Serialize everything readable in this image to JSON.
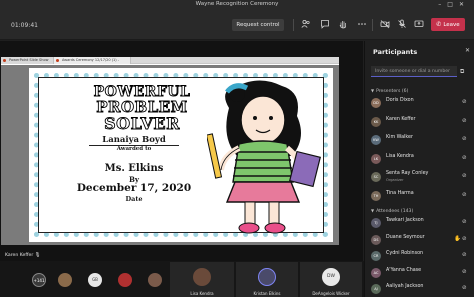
{
  "window": {
    "title": "Wayne Recognition Ceremony",
    "controls": [
      "–",
      "□",
      "✕"
    ]
  },
  "toolbar": {
    "timer": "01:09:41",
    "request_control_label": "Request control",
    "leave_label": "Leave"
  },
  "powerpoint": {
    "tab1": "PowerPoint Slide Show",
    "tab2": "Awards Ceremony 12/17/20 (1) - PowerPoint"
  },
  "certificate": {
    "title_line1": "POWERFUL",
    "title_line2": "PROBLEM",
    "title_line3": "SOLVER",
    "recipient": "Lanaiya Boyd",
    "awarded_to": "Awarded to",
    "presenter": "Ms. Elkins",
    "by": "By",
    "date": "December 17, 2020",
    "date_label": "Date"
  },
  "participants": {
    "title": "Participants",
    "invite_placeholder": "Invite someone or dial a number",
    "presenters_header": "Presenters (6)",
    "presenters": [
      {
        "name": "Doris Dixon",
        "initials": "DD",
        "color": "#8a6d5a"
      },
      {
        "name": "Karen Keffer",
        "initials": "KK",
        "color": "#6b5a4a"
      },
      {
        "name": "Kim Walker",
        "initials": "KW",
        "color": "#5a6b7a"
      },
      {
        "name": "Lisa Kendra",
        "initials": "LK",
        "color": "#7a5a5a"
      },
      {
        "name": "Senta Ray Conley",
        "role": "Organizer",
        "initials": "SC",
        "color": "#6a6a5a"
      },
      {
        "name": "Tina Harma",
        "initials": "TH",
        "color": "#7a6a5a"
      }
    ],
    "attendees_header": "Attendees (143)",
    "attendees": [
      {
        "name": "Tawkari Jackson",
        "initials": "TJ",
        "color": "#5a5a6a",
        "hand": false
      },
      {
        "name": "Duane Seymour",
        "initials": "DS",
        "color": "#6a5a5a",
        "hand": true
      },
      {
        "name": "Cydni Robinson",
        "initials": "CR",
        "color": "#5a6a6a",
        "hand": false
      },
      {
        "name": "A'Yanna Chase",
        "initials": "AC",
        "color": "#7a5a6a",
        "hand": false
      },
      {
        "name": "Aaliyah Jackson",
        "initials": "AJ",
        "color": "#5a6a5a",
        "hand": false
      }
    ]
  },
  "bottom": {
    "self_name": "Karen Keffer",
    "more_count": "+141",
    "avatars": [
      {
        "initials": "",
        "color": "#8a6a4a"
      },
      {
        "initials": "GB",
        "color": "#e6e6e6"
      },
      {
        "initials": "",
        "color": "#b03030"
      },
      {
        "initials": "",
        "color": "#7a5a4a"
      }
    ],
    "tiles": [
      {
        "name": "Lisa Kendra",
        "initials": "",
        "color": "#6a4a3a"
      },
      {
        "name": "Kristan Elkins",
        "initials": "",
        "color": "#4a4a6a"
      },
      {
        "name": "DeAngelois Wicker",
        "initials": "DW",
        "color": "#e8e8e8"
      }
    ]
  },
  "colors": {
    "accent": "#5b5fc7",
    "leave": "#c4314b",
    "frame_dots": "#9fd3e0"
  }
}
